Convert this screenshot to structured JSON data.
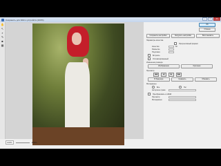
{
  "window": {
    "title": "Сохранить для Web и устройств (100%)",
    "min": "–",
    "max": "□",
    "close": "✕"
  },
  "tools": [
    {
      "icon": "hand-icon",
      "glyph": "✋"
    },
    {
      "icon": "slice-select-icon",
      "glyph": "↖"
    },
    {
      "icon": "zoom-icon",
      "glyph": "⌕"
    },
    {
      "icon": "eyedropper-icon",
      "glyph": "✎"
    },
    {
      "icon": "color-swatch-icon",
      "glyph": "■"
    },
    {
      "icon": "toggle-slices-icon",
      "glyph": "▦"
    }
  ],
  "status": {
    "zoom": "100%",
    "info": "JPEG"
  },
  "panel": {
    "top_buttons": [
      "OK",
      "Отмена"
    ],
    "preset_buttons": [
      "Сохранить настройки",
      "Загрузить настройки",
      "Восстановить"
    ],
    "section_quality": "Параметры качества",
    "checkbox_progressive": "Прогрессивный формат",
    "quality_label": "Качество",
    "quality_value": "60",
    "blur_label": "Размытие",
    "matte_label": "Подложка",
    "embed_label": "Встроить",
    "optimized_label": "Оптимизированный",
    "section_resize": "Изменение размера",
    "size_buttons": [
      "Изображение",
      "Оригинал"
    ],
    "section_preview": "Просмотр",
    "nav": [
      "◀◀",
      "◀",
      "▶",
      "▶▶"
    ],
    "preview_buttons": [
      "В браузере",
      "Сравнить",
      "Обновить"
    ],
    "section_metadata": "Метаданные",
    "radio_all": "Все",
    "radio_none": "Нет",
    "copyright_label": "Авторское право",
    "section_color": "Преобразовать в sRGB",
    "preview_label": "Просмотр",
    "metadata_label": "Метаданные"
  }
}
